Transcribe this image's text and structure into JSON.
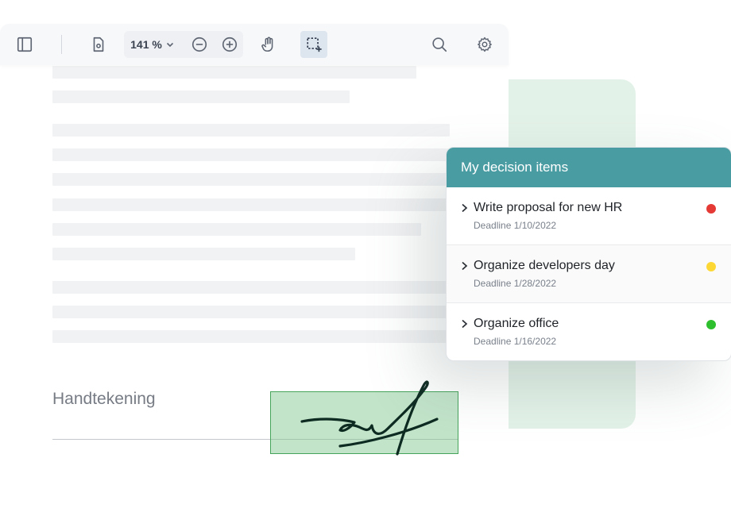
{
  "toolbar": {
    "zoom_value": "141 %",
    "icons": [
      "sidebar-toggle-icon",
      "page-settings-icon",
      "chevron-down-icon",
      "zoom-out-icon",
      "zoom-in-icon",
      "hand-icon",
      "area-select-icon",
      "search-icon",
      "gear-icon"
    ],
    "active_tool": "area-select"
  },
  "document": {
    "signature_label": "Handtekening"
  },
  "decision_panel": {
    "title": "My decision items",
    "header_color": "#4a9ca3",
    "items": [
      {
        "title": "Write proposal for new HR",
        "deadline": "Deadline 1/10/2022",
        "status_color": "#e53935"
      },
      {
        "title": "Organize developers day",
        "deadline": "Deadline 1/28/2022",
        "status_color": "#fdd835"
      },
      {
        "title": "Organize office",
        "deadline": "Deadline 1/16/2022",
        "status_color": "#2ebf2e"
      }
    ]
  },
  "colors": {
    "accent_green_panel": "#e3f2e8",
    "signature_box": "#78c488",
    "signature_ink": "#0e2b22"
  }
}
